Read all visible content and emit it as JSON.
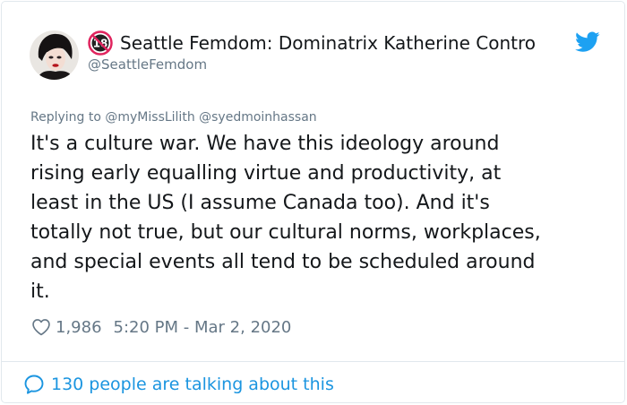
{
  "author": {
    "display_name": "Seattle Femdom: Dominatrix Katherine Contro",
    "handle": "@SeattleFemdom",
    "badge_icon": "eighteen-plus-icon",
    "avatar_icon": "avatar"
  },
  "replying": {
    "text": "Replying to @myMissLilith @syedmoinhassan"
  },
  "tweet": {
    "text": "It's a culture war. We have this ideology around\nrising early equalling virtue and productivity, at\nleast in the US (I assume Canada too). And it's\ntotally not true, but our cultural norms, workplaces,\nand special events all tend to be scheduled around\nit."
  },
  "meta": {
    "likes": "1,986",
    "timestamp": "5:20 PM - Mar 2, 2020"
  },
  "footer": {
    "talking": "130 people are talking about this"
  },
  "colors": {
    "brand_blue": "#1da1f2",
    "link_blue": "#1b95e0",
    "secondary_text": "#657786",
    "badge_red": "#e0245e"
  }
}
